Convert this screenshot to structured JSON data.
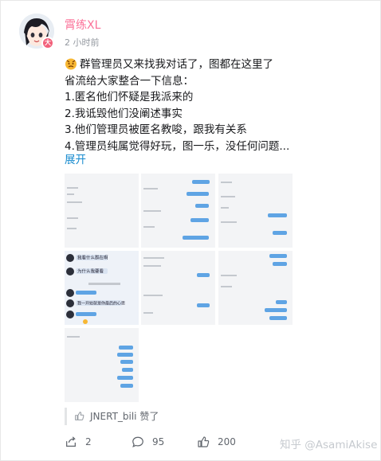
{
  "author": {
    "name": "霄练XL",
    "avatar_badge": "大",
    "time": "2 小时前"
  },
  "post": {
    "lines": [
      "群管理员又来找我对话了，图都在这里了",
      "省流给大家整合一下信息：",
      "1.匿名他们怀疑是我派来的",
      "2.我诋毁他们没阐述事实",
      "3.他们管理员被匿名教唆，跟我有关系",
      "4.管理员纯属觉得好玩，图一乐，没任何问题..."
    ],
    "expand_label": "展开",
    "images": [
      {
        "label": "",
        "chat_lines": []
      },
      {
        "label": "",
        "chat_lines": []
      },
      {
        "label": "",
        "chat_lines": []
      },
      {
        "label": "",
        "chat_lines": [
          "我看什么群在啊",
          "为什么我要看",
          "我一开始就是你最后的心思"
        ]
      },
      {
        "label": "",
        "chat_lines": []
      },
      {
        "label": "",
        "chat_lines": []
      },
      {
        "label": "",
        "chat_lines": []
      }
    ]
  },
  "likes": {
    "user": "JNERT_bili",
    "suffix": "赞了"
  },
  "actions": {
    "share_count": "2",
    "comment_count": "95",
    "like_count": "200"
  },
  "watermark": "知乎 @AsamiAkise",
  "colors": {
    "username": "#fb7299",
    "link": "#178bcf",
    "bubble_blue": "#5fa4e4"
  }
}
